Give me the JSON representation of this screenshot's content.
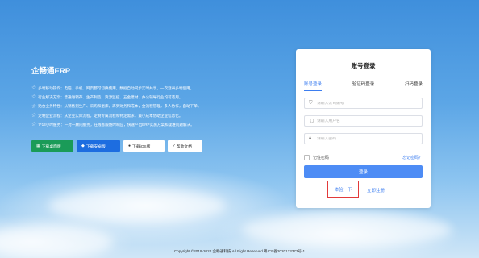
{
  "left": {
    "brand": "企畅通ERP",
    "features": [
      "多端移动操作：电脑、手机、网页都可切换使用，数据自动同步实时共享，一次登录多端使用。",
      "行业解决方案：普通进销存、生产制造、资源监控、五金建材、办公辅导行业均可适用。",
      "贴合业务特性：从销售到生产、采购和退库，再到财务和成本，全流程管理，多人协作，自动下单。",
      "定制企业流程：从企业实际流程，定制专属流程和特定需求，最小成本协助企业信息化。",
      "7*13小时服务：一对一顾问服务，在线客服随时响应，快速产出ERP实施方案和疑难问题解决。"
    ],
    "buttons": {
      "windows": "下载桌面版",
      "android": "下载安卓版",
      "ios": "下载iOS版",
      "help": "帮助文档"
    }
  },
  "login": {
    "title": "账号登录",
    "tabs": [
      "账号登录",
      "验证码登录",
      "扫码登录"
    ],
    "company_placeholder": "请输入公司编号",
    "user_placeholder": "请输入用户名",
    "password_placeholder": "请输入密码",
    "remember": "记住密码",
    "forgot": "忘记密码？",
    "login_button": "登录",
    "try_button": "体验一下",
    "register": "立即注册"
  },
  "footer": "Copyright ©2019-2024 企畅通科技 All Right Reserved 粤ICP备2020123373号-1"
}
